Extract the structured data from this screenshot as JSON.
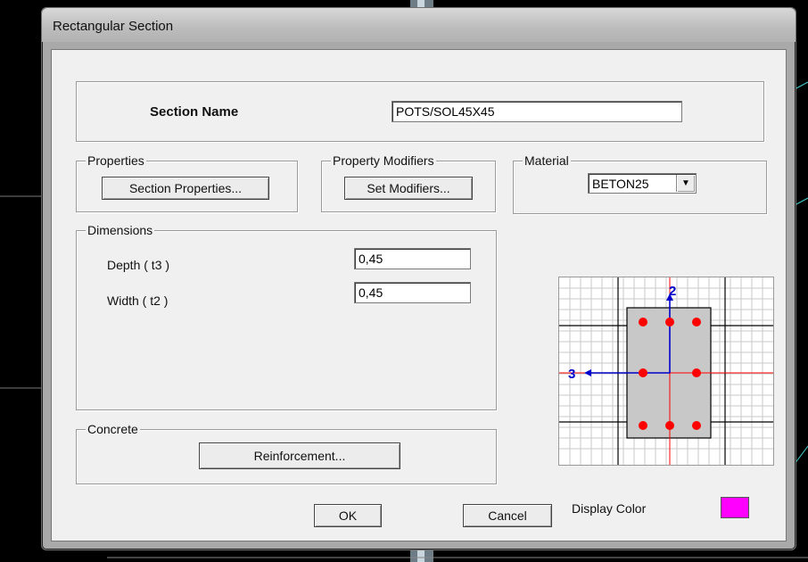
{
  "window": {
    "title": "Rectangular Section"
  },
  "section_name": {
    "label": "Section Name",
    "value": "POTS/SOL45X45"
  },
  "properties": {
    "group": "Properties",
    "button": "Section Properties..."
  },
  "modifiers": {
    "group": "Property Modifiers",
    "button": "Set Modifiers..."
  },
  "material": {
    "group": "Material",
    "selected": "BETON25"
  },
  "dimensions": {
    "group": "Dimensions",
    "depth_label": "Depth  ( t3 )",
    "depth_value": "0,45",
    "width_label": "Width  ( t2 )",
    "width_value": "0,45"
  },
  "concrete": {
    "group": "Concrete",
    "button": "Reinforcement..."
  },
  "preview": {
    "axis_vertical": "2",
    "axis_horizontal": "3",
    "rebar_count": 8
  },
  "display_color": {
    "label": "Display Color",
    "color": "#ff00ff"
  },
  "footer": {
    "ok": "OK",
    "cancel": "Cancel"
  },
  "colors": {
    "rebar": "#ff0000",
    "axis": "#0000cc",
    "section_fill": "#c8c8c8"
  }
}
